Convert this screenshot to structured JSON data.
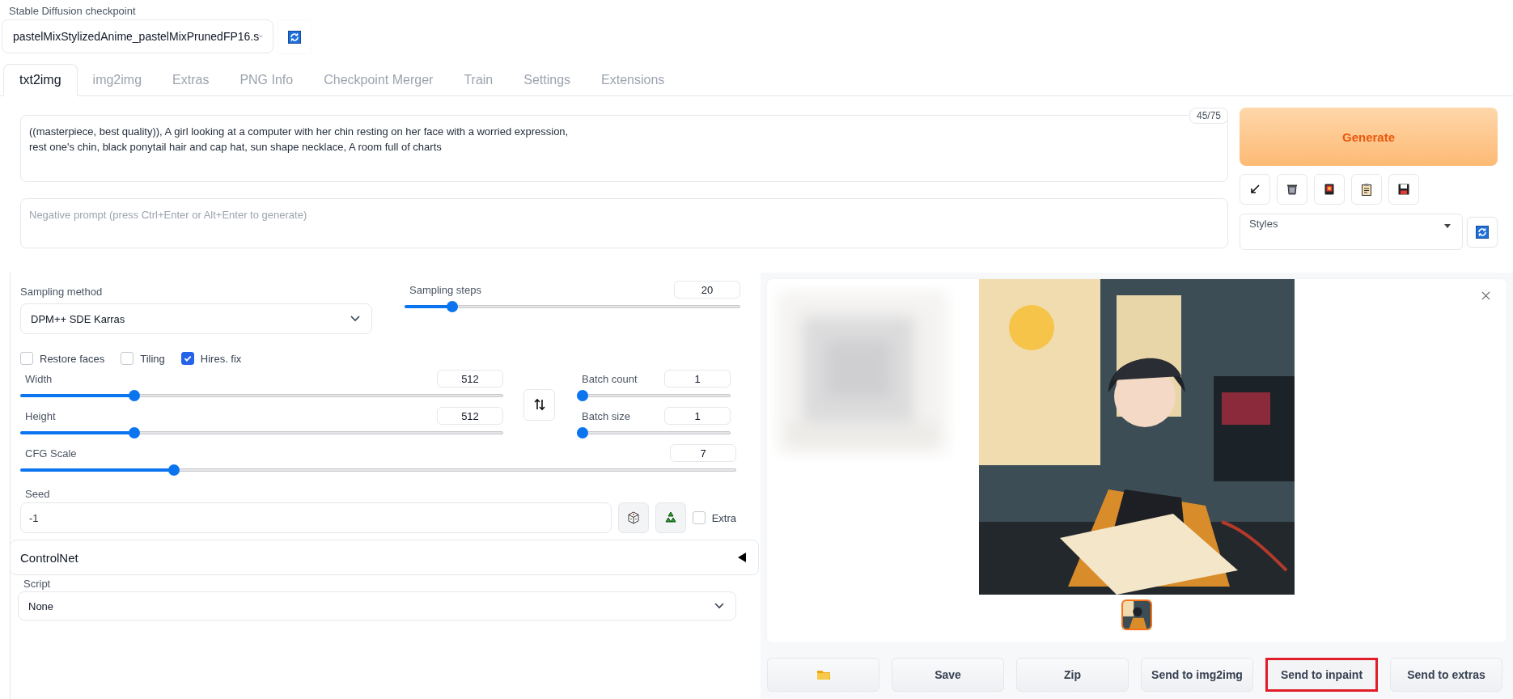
{
  "checkpoint": {
    "label": "Stable Diffusion checkpoint",
    "value": "pastelMixStylizedAnime_pastelMixPrunedFP16.s"
  },
  "tabs": [
    {
      "label": "txt2img",
      "selected": true
    },
    {
      "label": "img2img",
      "selected": false
    },
    {
      "label": "Extras",
      "selected": false
    },
    {
      "label": "PNG Info",
      "selected": false
    },
    {
      "label": "Checkpoint Merger",
      "selected": false
    },
    {
      "label": "Train",
      "selected": false
    },
    {
      "label": "Settings",
      "selected": false
    },
    {
      "label": "Extensions",
      "selected": false
    }
  ],
  "prompt": {
    "value": "((masterpiece, best quality)), A girl looking at a computer with her chin resting on her face with a worried expression,\nrest one's chin, black ponytail hair and cap hat, sun shape necklace, A room full of charts",
    "token_count": "45/75"
  },
  "negative_prompt": {
    "placeholder": "Negative prompt (press Ctrl+Enter or Alt+Enter to generate)"
  },
  "generate_button": "Generate",
  "styles": {
    "label": "Styles"
  },
  "sampling_method": {
    "label": "Sampling method",
    "value": "DPM++ SDE Karras"
  },
  "sampling_steps": {
    "label": "Sampling steps",
    "value": "20",
    "level": 0.13
  },
  "checkboxes": [
    {
      "label": "Restore faces",
      "checked": false
    },
    {
      "label": "Tiling",
      "checked": false
    },
    {
      "label": "Hires. fix",
      "checked": true
    }
  ],
  "width": {
    "label": "Width",
    "value": "512",
    "level": 0.23
  },
  "height": {
    "label": "Height",
    "value": "512",
    "level": 0.23
  },
  "batch_count": {
    "label": "Batch count",
    "value": "1",
    "level": 0
  },
  "batch_size": {
    "label": "Batch size",
    "value": "1",
    "level": 0
  },
  "cfg_scale": {
    "label": "CFG Scale",
    "value": "7",
    "level": 0.21
  },
  "seed": {
    "label": "Seed",
    "value": "-1"
  },
  "extra": {
    "label": "Extra",
    "checked": false
  },
  "controlnet": {
    "label": "ControlNet",
    "expanded": false
  },
  "script": {
    "label": "Script",
    "value": "None"
  },
  "gallery": {
    "thumbnails": [
      {
        "selected": true
      }
    ]
  },
  "action_buttons": [
    {
      "kind": "folder",
      "highlighted": false
    },
    {
      "kind": "text",
      "label": "Save",
      "highlighted": false
    },
    {
      "kind": "text",
      "label": "Zip",
      "highlighted": false
    },
    {
      "kind": "text",
      "label": "Send to img2img",
      "highlighted": false
    },
    {
      "kind": "text",
      "label": "Send to inpaint",
      "highlighted": true
    },
    {
      "kind": "text",
      "label": "Send to extras",
      "highlighted": false
    }
  ]
}
